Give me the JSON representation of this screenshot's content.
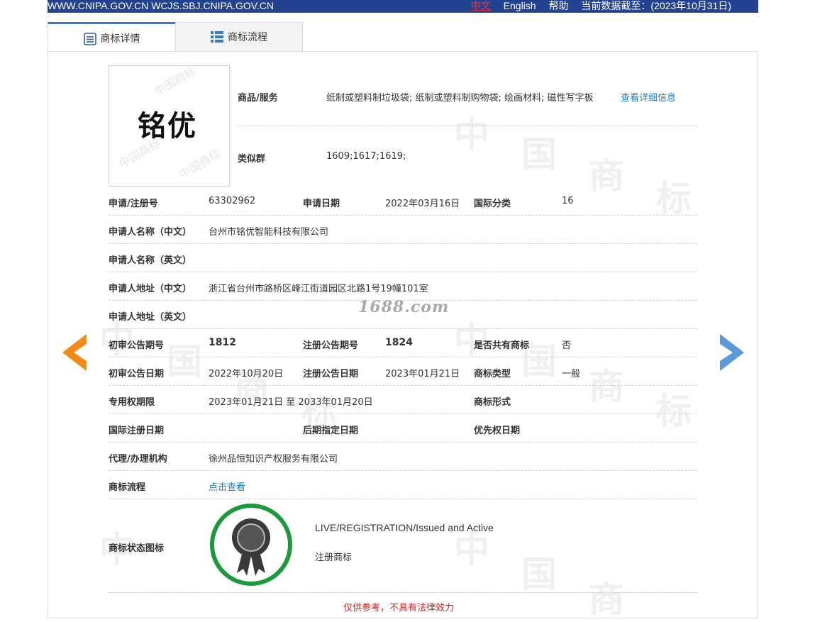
{
  "topbar": {
    "domains": "WWW.CNIPA.GOV.CN WCJS.SBJ.CNIPA.GOV.CN",
    "lang_zh": "中文",
    "lang_en": "English",
    "help": "帮助",
    "data_date": "当前数据截至：(2023年10月31日)"
  },
  "tabs": [
    {
      "label": "商标详情",
      "active": true
    },
    {
      "label": "商标流程",
      "active": false
    }
  ],
  "logo": {
    "text": "铭优"
  },
  "goods": {
    "label": "商品/服务",
    "value": "纸制或塑料制垃圾袋; 纸制或塑料制购物袋; 绘画材料; 磁性写字板",
    "link": "查看详细信息"
  },
  "similar_group": {
    "label": "类似群",
    "value": "1609;1617;1619;"
  },
  "rows": {
    "reg_no": {
      "label": "申请/注册号",
      "value": "63302962"
    },
    "app_date": {
      "label": "申请日期",
      "value": "2022年03月16日"
    },
    "intl_class": {
      "label": "国际分类",
      "value": "16"
    },
    "applicant_cn": {
      "label": "申请人名称（中文）",
      "value": "台州市铭优智能科技有限公司"
    },
    "applicant_en": {
      "label": "申请人名称（英文）",
      "value": ""
    },
    "address_cn": {
      "label": "申请人地址（中文）",
      "value": "浙江省台州市路桥区峰江街道园区北路1号19幢101室"
    },
    "address_en": {
      "label": "申请人地址（英文）",
      "value": ""
    },
    "prelim_issue": {
      "label": "初审公告期号",
      "value": "1812"
    },
    "reg_issue": {
      "label": "注册公告期号",
      "value": "1824"
    },
    "shared": {
      "label": "是否共有商标",
      "value": "否"
    },
    "prelim_date": {
      "label": "初审公告日期",
      "value": "2022年10月20日"
    },
    "reg_date": {
      "label": "注册公告日期",
      "value": "2023年01月21日"
    },
    "tm_type": {
      "label": "商标类型",
      "value": "一般"
    },
    "exclusive": {
      "label": "专用权期限",
      "value": "2023年01月21日 至 2033年01月20日"
    },
    "tm_form": {
      "label": "商标形式",
      "value": ""
    },
    "intl_reg_date": {
      "label": "国际注册日期",
      "value": ""
    },
    "later_date": {
      "label": "后期指定日期",
      "value": ""
    },
    "priority_date": {
      "label": "优先权日期",
      "value": ""
    },
    "agent": {
      "label": "代理/办理机构",
      "value": "徐州品恒知识产权服务有限公司"
    },
    "flow": {
      "label": "商标流程",
      "link": "点击查看"
    },
    "status_icon": {
      "label": "商标状态图标",
      "status_en": "LIVE/REGISTRATION/Issued and Active",
      "status_cn": "注册商标"
    }
  },
  "watermark_site": "1688.com",
  "disclaimer": "仅供参考，不具有法律效力",
  "colors": {
    "topbar": "#1e3f8f",
    "link": "#1a7ec8",
    "seal_ring": "#1a9a3a",
    "left_arrow": "#f28b14",
    "right_arrow": "#5a9ad8",
    "disclaimer": "#e02020"
  }
}
